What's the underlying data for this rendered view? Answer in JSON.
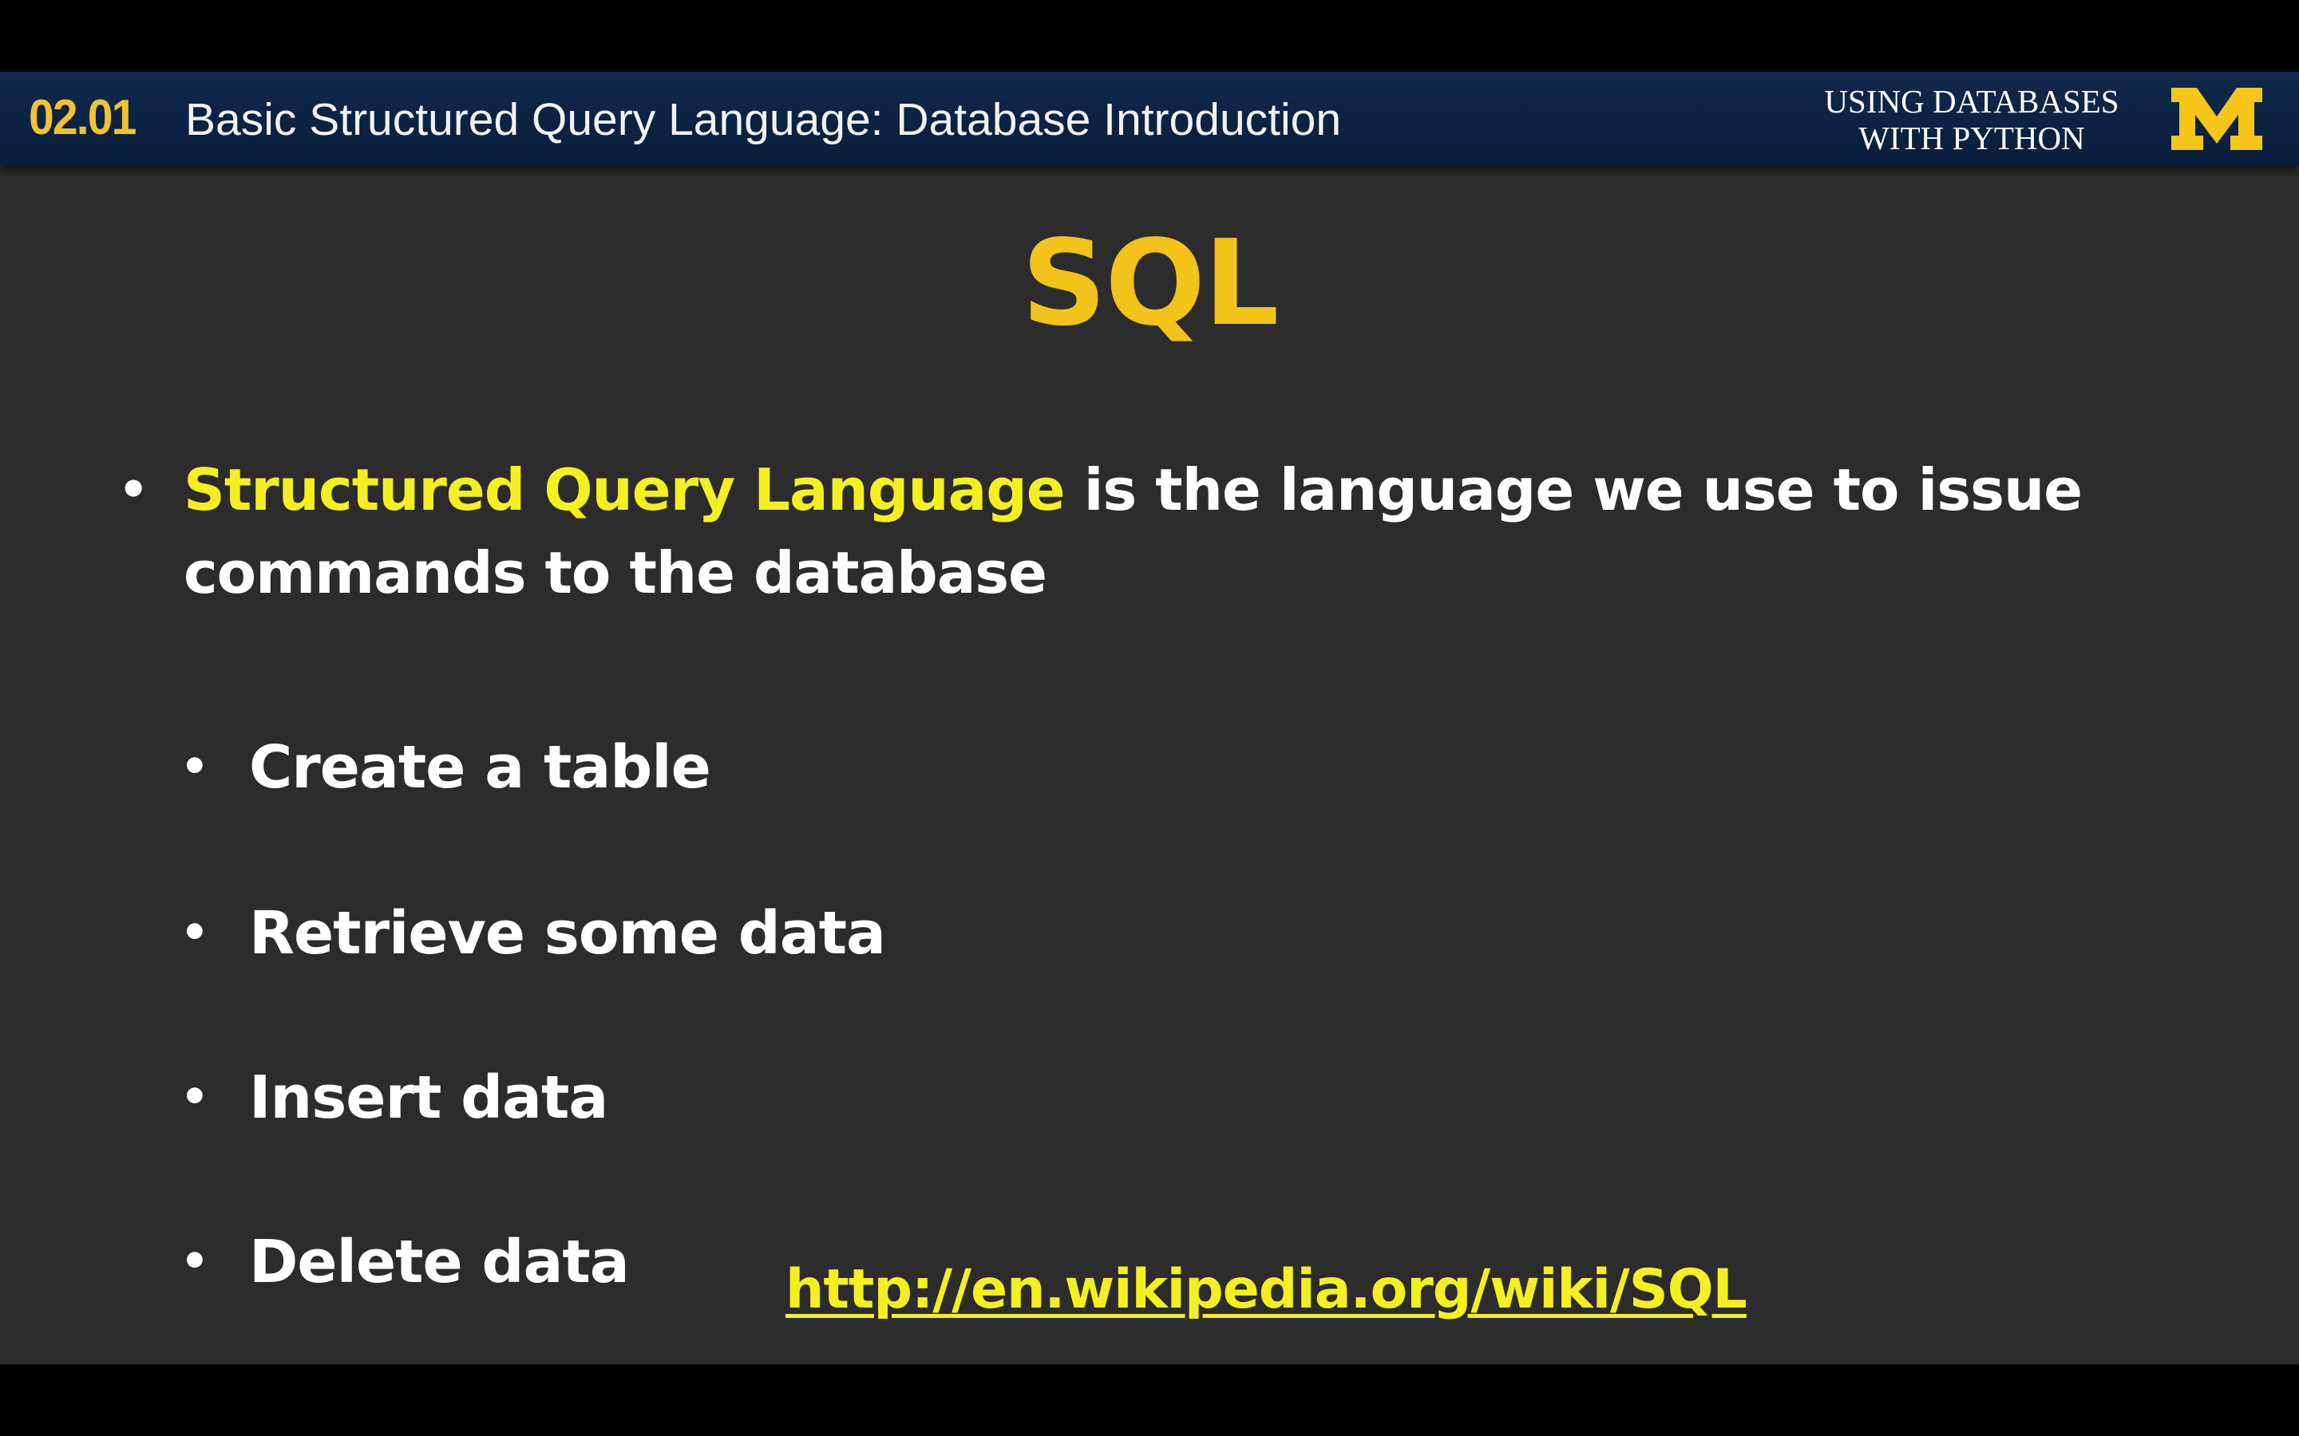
{
  "header": {
    "lesson_number": "02.01",
    "lesson_title": "Basic Structured Query Language: Database Introduction",
    "course_line_1": "USING DATABASES",
    "course_line_2": "WITH PYTHON",
    "logo_icon": "block-m-logo-icon"
  },
  "slide": {
    "title": "SQL",
    "main_bullet": {
      "highlight": "Structured Query Language",
      "rest_line_1": " is the language we use to issue",
      "rest_line_2": "commands to the database"
    },
    "sub_bullets": [
      "Create a table",
      "Retrieve some data",
      "Insert data",
      "Delete data"
    ],
    "link": "http://en.wikipedia.org/wiki/SQL"
  },
  "colors": {
    "header_bg": "#0b2242",
    "lesson_number": "#f1c232",
    "title": "#f2c318",
    "highlight": "#f4f020",
    "slide_bg": "#2c2c2c",
    "letterbox": "#000000",
    "logo": "#f5c518"
  }
}
